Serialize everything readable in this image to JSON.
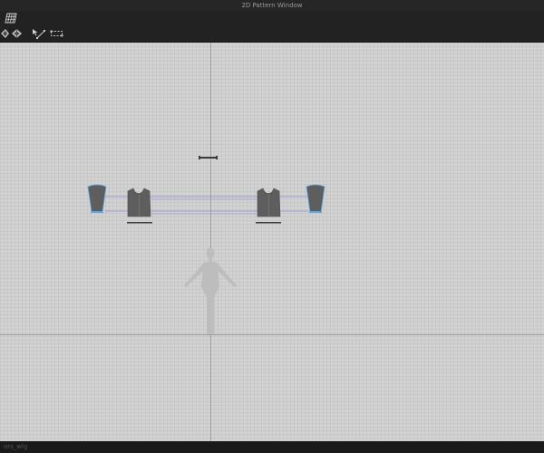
{
  "window": {
    "title": "2D Pattern Window"
  },
  "toolbar": {
    "row1": [
      {
        "icon": "grid-pattern-icon"
      }
    ],
    "row2": [
      {
        "icon": "transform-diamond-icon"
      },
      {
        "icon": "segment-diamond-icon"
      },
      {
        "icon": "edit-point-line-icon"
      },
      {
        "icon": "dashed-selection-icon"
      }
    ]
  },
  "colors": {
    "canvas_bg": "#d2d2d2",
    "pattern_fill": "#5e5e5e",
    "seam_line": "#8a8ad8",
    "selected_edge": "#5aa9e6",
    "avatar_silhouette": "#bcbcbc"
  },
  "canvas": {
    "pieces": [
      {
        "name": "left-sleeve",
        "selected": true
      },
      {
        "name": "front-bodice",
        "selected": false
      },
      {
        "name": "back-bodice",
        "selected": false
      },
      {
        "name": "right-sleeve",
        "selected": true
      },
      {
        "name": "collar-strip",
        "selected": false
      }
    ]
  },
  "status": {
    "text": "ors_wlg"
  }
}
